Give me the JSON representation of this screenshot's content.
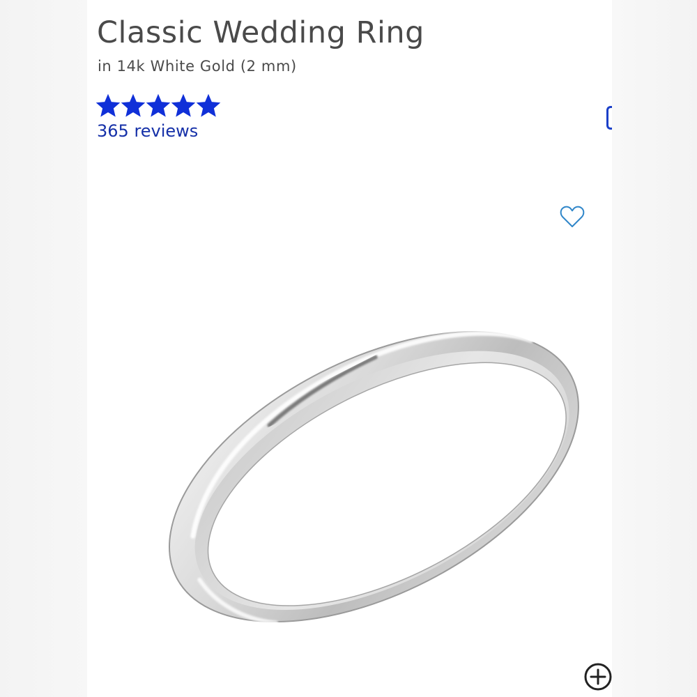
{
  "product": {
    "title": "Classic Wedding Ring",
    "subtitle": "in 14k White Gold (2 mm)"
  },
  "rating": {
    "stars": 5,
    "max_stars": 5,
    "reviews_label": "365 reviews"
  },
  "icons": {
    "star": "star-icon",
    "wishlist": "heart-outline-icon",
    "zoom": "plus-circle-icon"
  },
  "colors": {
    "star": "#1030d8",
    "link": "#1530a8",
    "heart": "#2f86c9",
    "title": "#4a4a4a"
  }
}
